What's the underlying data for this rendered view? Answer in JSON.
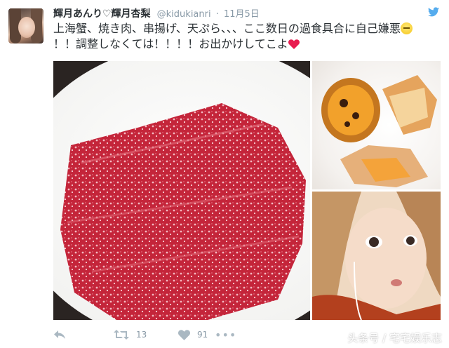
{
  "tweet": {
    "display_name": "輝月あんり♡輝月杏梨",
    "handle": "@kidukianri",
    "separator": "·",
    "date": "11月5日",
    "text_line1": "上海蟹、焼き肉、串揚げ、天ぷら、、、ここ数日の過食具合に自己嫌悪",
    "text_line2": "！！調整しなくては！！！！お出かけしてこよ",
    "emoji_1": "neutral-face-emoji",
    "emoji_2": "heart-emoji"
  },
  "actions": {
    "retweet_count": "13",
    "like_count": "91",
    "more_label": "•••"
  },
  "watermark": "头条号 / 宅宅娱乐志",
  "colors": {
    "text": "#292f33",
    "muted": "#8899a6",
    "bird": "#55acee",
    "heart": "#e81c4f",
    "action_icon": "#aab8c2"
  },
  "icons": {
    "brand": "twitter-bird-icon",
    "reply": "reply-icon",
    "retweet": "retweet-icon",
    "like": "heart-icon",
    "more": "more-icon"
  }
}
